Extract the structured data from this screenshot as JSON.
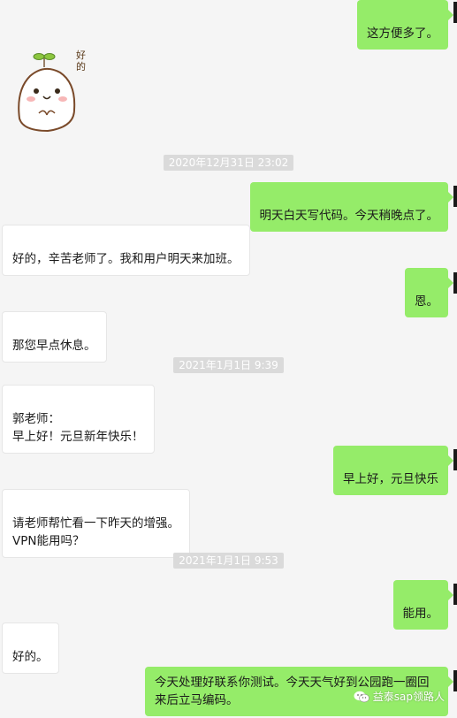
{
  "sticker": {
    "icon": "mochi-sticker-icon",
    "text": "好的"
  },
  "messages": [
    {
      "side": "right",
      "text": "这方便多了。"
    },
    {
      "side": "left",
      "text": "好的，辛苦老师了。我和用户明天来加班。"
    },
    {
      "side": "right",
      "text": "明天白天写代码。今天稍晚点了。"
    },
    {
      "side": "right",
      "text": "恩。"
    },
    {
      "side": "left",
      "text": "那您早点休息。"
    },
    {
      "side": "left",
      "text": "郭老师：\n早上好！元旦新年快乐！"
    },
    {
      "side": "right",
      "text": "早上好，元旦快乐"
    },
    {
      "side": "left",
      "text": "请老师帮忙看一下昨天的增强。\nVPN能用吗？"
    },
    {
      "side": "right",
      "text": "能用。"
    },
    {
      "side": "left",
      "text": "好的。"
    },
    {
      "side": "right",
      "text": "今天处理好联系你测试。今天天气好到公园跑一圈回来后立马编码。"
    }
  ],
  "timestamps": [
    "2020年12月31日 23:02",
    "2021年1月1日 9:39",
    "2021年1月1日 9:53"
  ],
  "watermark": {
    "icon": "wechat-icon",
    "text": "益泰sap领路人"
  }
}
